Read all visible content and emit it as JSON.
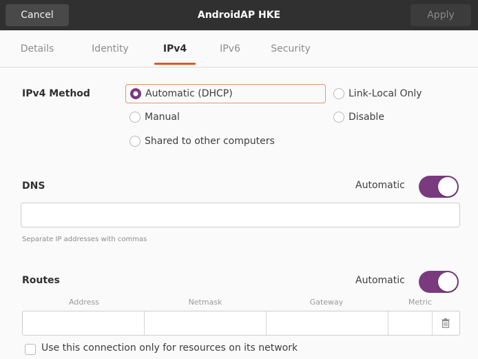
{
  "header": {
    "cancel_label": "Cancel",
    "title": "AndroidAP HKE",
    "apply_label": "Apply"
  },
  "tabs": [
    {
      "label": "Details",
      "active": false
    },
    {
      "label": "Identity",
      "active": false
    },
    {
      "label": "IPv4",
      "active": true
    },
    {
      "label": "IPv6",
      "active": false
    },
    {
      "label": "Security",
      "active": false
    }
  ],
  "ipv4": {
    "method_label": "IPv4 Method",
    "options": [
      {
        "label": "Automatic (DHCP)",
        "selected": true
      },
      {
        "label": "Link-Local Only",
        "selected": false
      },
      {
        "label": "Manual",
        "selected": false
      },
      {
        "label": "Disable",
        "selected": false
      },
      {
        "label": "Shared to other computers",
        "selected": false
      }
    ]
  },
  "dns": {
    "heading": "DNS",
    "automatic_label": "Automatic",
    "automatic_on": true,
    "value": "",
    "hint": "Separate IP addresses with commas"
  },
  "routes": {
    "heading": "Routes",
    "automatic_label": "Automatic",
    "automatic_on": true,
    "columns": [
      "Address",
      "Netmask",
      "Gateway",
      "Metric"
    ],
    "row": {
      "address": "",
      "netmask": "",
      "gateway": "",
      "metric": ""
    }
  },
  "only_resources": {
    "label": "Use this connection only for resources on its network",
    "checked": false
  },
  "colors": {
    "accent_purple": "#7a3a7e",
    "tab_underline": "#e95420",
    "titlebar": "#303030"
  }
}
